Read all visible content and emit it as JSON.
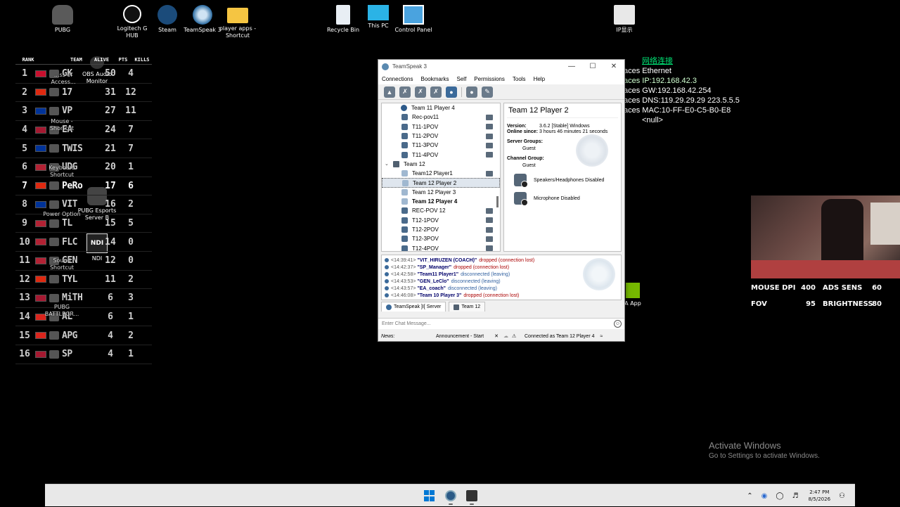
{
  "desktop_icons": [
    {
      "label": "PUBG",
      "icon": "pubg-icon"
    },
    {
      "label": "Logitech G HUB",
      "icon": "logitech-icon"
    },
    {
      "label": "Steam",
      "icon": "steam-icon"
    },
    {
      "label": "TeamSpeak 3",
      "icon": "teamspeak-icon"
    },
    {
      "label": "player apps - Shortcut",
      "icon": "folder-icon"
    },
    {
      "label": "Recycle Bin",
      "icon": "recycle-bin-icon"
    },
    {
      "label": "This PC",
      "icon": "monitor-icon"
    },
    {
      "label": "Control Panel",
      "icon": "control-panel-icon"
    },
    {
      "label": "IP显示",
      "icon": "ip-display-icon"
    },
    {
      "label": "OBS Audio Monitor",
      "icon": "obs-icon"
    },
    {
      "label": "PUBG Esports Server B",
      "icon": "pubg-esports-icon"
    },
    {
      "label": "NDI",
      "icon": "ndi-icon"
    },
    {
      "label": "A App",
      "icon": "nvidia-icon"
    }
  ],
  "overlay_icon_labels": [
    "...ss of Access...",
    "Mouse - Shortcut",
    "Keyboard Shortcut",
    "Power Option",
    "Sound Shortcut",
    "PUBG BATTLEGR..."
  ],
  "leaderboard": {
    "headers": {
      "rank": "RANK",
      "team": "TEAM",
      "alive": "ALIVE",
      "pts": "PTS",
      "kills": "KILLS"
    },
    "rows": [
      {
        "rank": "1",
        "team": "GK",
        "pts": "50",
        "kills": "4",
        "flag": "#c8102e"
      },
      {
        "rank": "2",
        "team": "17",
        "pts": "31",
        "kills": "12",
        "flag": "#de2910"
      },
      {
        "rank": "3",
        "team": "VP",
        "pts": "27",
        "kills": "11",
        "flag": "#003399"
      },
      {
        "rank": "4",
        "team": "EA",
        "pts": "24",
        "kills": "7",
        "flag": "#a51931"
      },
      {
        "rank": "5",
        "team": "TWIS",
        "pts": "21",
        "kills": "7",
        "flag": "#003399"
      },
      {
        "rank": "6",
        "team": "UDG",
        "pts": "20",
        "kills": "1",
        "flag": "#b22234"
      },
      {
        "rank": "7",
        "team": "PeRo",
        "pts": "17",
        "kills": "6",
        "flag": "#de2910"
      },
      {
        "rank": "8",
        "team": "VIT",
        "pts": "16",
        "kills": "2",
        "flag": "#003399"
      },
      {
        "rank": "9",
        "team": "TL",
        "pts": "15",
        "kills": "5",
        "flag": "#b22234"
      },
      {
        "rank": "10",
        "team": "FLC",
        "pts": "14",
        "kills": "0",
        "flag": "#b22234"
      },
      {
        "rank": "11",
        "team": "GEN",
        "pts": "12",
        "kills": "0",
        "flag": "#b22234"
      },
      {
        "rank": "12",
        "team": "TYL",
        "pts": "11",
        "kills": "2",
        "flag": "#de2910"
      },
      {
        "rank": "13",
        "team": "MiTH",
        "pts": "6",
        "kills": "3",
        "flag": "#a51931"
      },
      {
        "rank": "14",
        "team": "AL",
        "pts": "6",
        "kills": "1",
        "flag": "#da251d"
      },
      {
        "rank": "15",
        "team": "APG",
        "pts": "4",
        "kills": "2",
        "flag": "#da251d"
      },
      {
        "rank": "16",
        "team": "SP",
        "pts": "4",
        "kills": "1",
        "flag": "#a51931"
      }
    ]
  },
  "netinfo": {
    "title": "网络连接",
    "lines": [
      "aces Ethernet",
      "aces IP:192.168.42.3",
      "aces GW:192.168.42.254",
      "aces DNS:119.29.29.29 223.5.5.5",
      "aces MAC:10-FF-E0-C5-B0-E8"
    ],
    "null_line": "<null>"
  },
  "stats": {
    "mouse_dpi_label": "MOUSE DPI",
    "mouse_dpi": "400",
    "ads_sens_label": "ADS SENS",
    "ads_sens": "60",
    "fov_label": "FOV",
    "fov": "95",
    "brightness_label": "BRIGHTNESS",
    "brightness": "80"
  },
  "activate": {
    "title": "Activate Windows",
    "subtitle": "Go to Settings to activate Windows."
  },
  "teamspeak": {
    "title": "TeamSpeak 3",
    "menu": [
      "Connections",
      "Bookmarks",
      "Self",
      "Permissions",
      "Tools",
      "Help"
    ],
    "tree": [
      {
        "label": "Team 11 Player 4",
        "kind": "srv",
        "indent": 1
      },
      {
        "label": "Rec-pov11",
        "kind": "user",
        "indent": 2,
        "flag": true
      },
      {
        "label": "T11-1POV",
        "kind": "user",
        "indent": 2,
        "flag": true
      },
      {
        "label": "T11-2POV",
        "kind": "user",
        "indent": 2,
        "flag": true
      },
      {
        "label": "T11-3POV",
        "kind": "user",
        "indent": 2,
        "flag": true
      },
      {
        "label": "T11-4POV",
        "kind": "user",
        "indent": 2,
        "flag": true
      },
      {
        "label": "Team 12",
        "kind": "ch",
        "indent": 0
      },
      {
        "label": "Team12 Player1",
        "kind": "mic",
        "indent": 2,
        "flag": true
      },
      {
        "label": "Team 12 Player 2",
        "kind": "mic",
        "indent": 2,
        "selected": true
      },
      {
        "label": "Team 12 Player 3",
        "kind": "mic",
        "indent": 2
      },
      {
        "label": "Team 12 Player 4",
        "kind": "mic",
        "indent": 2,
        "bold": true
      },
      {
        "label": "REC-POV 12",
        "kind": "user",
        "indent": 2,
        "flag": true
      },
      {
        "label": "T12-1POV",
        "kind": "user",
        "indent": 2,
        "flag": true
      },
      {
        "label": "T12-2POV",
        "kind": "user",
        "indent": 2,
        "flag": true
      },
      {
        "label": "T12-3POV",
        "kind": "user",
        "indent": 2,
        "flag": true
      },
      {
        "label": "T12-4POV",
        "kind": "user",
        "indent": 2,
        "flag": true
      }
    ],
    "info": {
      "nickname": "Team 12 Player 2",
      "version_label": "Version:",
      "version": "3.6.2 [Stable] Windows",
      "online_label": "Online since:",
      "online": "3 hours 46 minutes 21 seconds",
      "server_groups_label": "Server Groups:",
      "server_groups": "Guest",
      "channel_group_label": "Channel Group:",
      "channel_group": "Guest",
      "speakers_status": "Speakers/Headphones Disabled",
      "mic_status": "Microphone Disabled"
    },
    "log": [
      {
        "time": "<14:39:41>",
        "name": "\"VIT_HIRUZEN (COACH)\"",
        "msg": "dropped (connection lost)",
        "type": "red"
      },
      {
        "time": "<14:42:37>",
        "name": "\"SP_Manager\"",
        "msg": "dropped (connection lost)",
        "type": "red"
      },
      {
        "time": "<14:42:58>",
        "name": "\"Team11 Player1\"",
        "msg": "disconnected (leaving)",
        "type": "blue"
      },
      {
        "time": "<14:43:53>",
        "name": "\"GEN_LeClo\"",
        "msg": "disconnected (leaving)",
        "type": "blue"
      },
      {
        "time": "<14:43:57>",
        "name": "\"EA_coach\"",
        "msg": "disconnected (leaving)",
        "type": "blue"
      },
      {
        "time": "<14:46:08>",
        "name": "\"Team 10 Player 3\"",
        "msg": "dropped (connection lost)",
        "type": "red"
      }
    ],
    "tabs": [
      "TeamSpeak ]I[ Server",
      "Team 12"
    ],
    "chat_placeholder": "Enter Chat Message...",
    "status": {
      "news": "News:",
      "announcement": "Announcement - Start",
      "connection": "Connected as Team 12 Player 4"
    }
  },
  "taskbar": {
    "time": "2:47 PM",
    "date": "8/5/2026"
  }
}
